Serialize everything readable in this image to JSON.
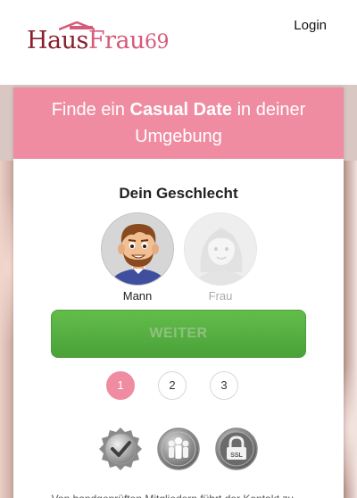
{
  "brand": {
    "logo_haus": "Haus",
    "logo_frau": "Frau",
    "logo_number": "69",
    "accent": "#f08ca1",
    "logo_dark": "#8a1e2c"
  },
  "header": {
    "login_label": "Login"
  },
  "card": {
    "headline_pre": "Finde ein ",
    "headline_bold": "Casual Date",
    "headline_post": " in deiner Umgebung",
    "gender_title": "Dein Geschlecht",
    "gender_options": [
      {
        "label": "Mann",
        "icon": "male-avatar-icon",
        "selected": true
      },
      {
        "label": "Frau",
        "icon": "female-avatar-icon",
        "selected": false
      }
    ],
    "continue_label": "WEITER",
    "steps": [
      "1",
      "2",
      "3"
    ],
    "active_step": "1",
    "badges": [
      "verified-check-badge-icon",
      "community-members-badge-icon",
      "ssl-lock-badge-icon"
    ],
    "ssl_text": "SSL",
    "footer_text": "Von handgeprüften Mitgliedern führt der Kontakt zu ..."
  }
}
